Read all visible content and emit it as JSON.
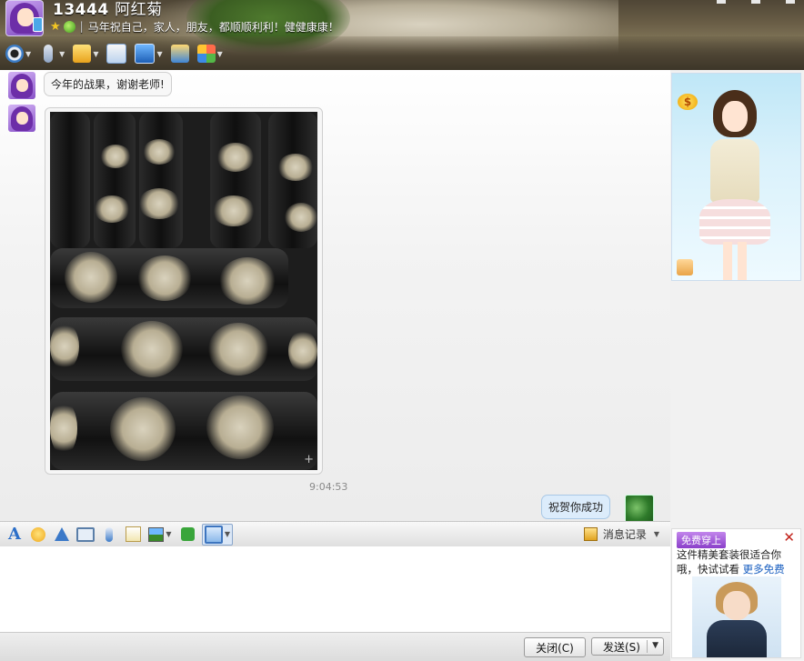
{
  "window": {
    "contact_id": "13444",
    "contact_nick": "阿红菊",
    "signature": "马年祝自己，家人，朋友，都顺顺利利！健健康康！"
  },
  "toolbar": {
    "items": [
      "video-call",
      "voice-call",
      "send-file",
      "create-discussion",
      "remote-desktop",
      "share-screen",
      "apps"
    ]
  },
  "messages": [
    {
      "from": "contact",
      "type": "text",
      "text": "今年的战果，谢谢老师!"
    },
    {
      "from": "contact",
      "type": "image",
      "description": "photo"
    },
    {
      "type": "timestamp",
      "text": "9:04:53"
    },
    {
      "from": "me",
      "type": "text",
      "text": "祝贺你成功"
    }
  ],
  "input_toolbar": {
    "history_label": "消息记录"
  },
  "buttons": {
    "close_label": "关闭(C)",
    "send_label": "发送(S)"
  },
  "right_panel": {
    "coin_symbol": "$",
    "ad": {
      "badge": "免费穿上",
      "text": "这件精美套装很适合你哦，快试试看",
      "link": "更多免费"
    }
  },
  "colors": {
    "accent_blue": "#3b7cc6",
    "bubble_out": "#dcecfb",
    "ad_purple": "#8a3fc9"
  }
}
